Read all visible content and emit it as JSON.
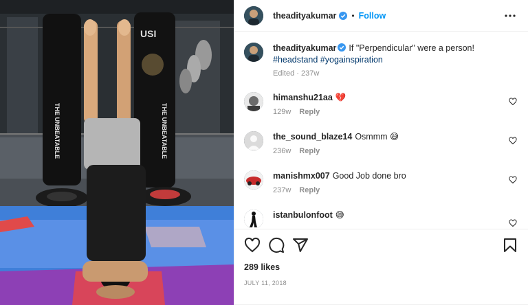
{
  "post": {
    "username": "theadityakumar",
    "follow_label": "Follow",
    "separator": "•",
    "caption_text": "If \"Perpendicular\" were a person!",
    "caption_tags": "#headstand #yogainspiration",
    "caption_meta": "Edited · 237w",
    "likes": "289 likes",
    "date": "JULY 11, 2018"
  },
  "photo": {
    "text_left": "THE UNBEATABLE",
    "text_right": "THE UNBEATABLE",
    "bag_logo": "USI"
  },
  "comments": [
    {
      "username": "himanshu21aa",
      "text": "💔",
      "age": "129w",
      "reply": "Reply"
    },
    {
      "username": "the_sound_blaze14",
      "text": "Osmmm 😅",
      "age": "236w",
      "reply": "Reply"
    },
    {
      "username": "manishmx007",
      "text": "Good Job done bro",
      "age": "237w",
      "reply": "Reply"
    },
    {
      "username": "istanbulonfoot",
      "text": "😅",
      "age": "",
      "reply": ""
    }
  ],
  "colors": {
    "accent": "#0095f6",
    "verified": "#3897f0",
    "hashtag": "#00376b",
    "muted": "#8e8e8e",
    "mat_blue": "#4a86e0",
    "mat_purple": "#8a3fb8"
  },
  "icons": [
    "verified-icon",
    "more-options-icon",
    "heart-icon",
    "comment-icon",
    "share-icon",
    "bookmark-icon"
  ]
}
